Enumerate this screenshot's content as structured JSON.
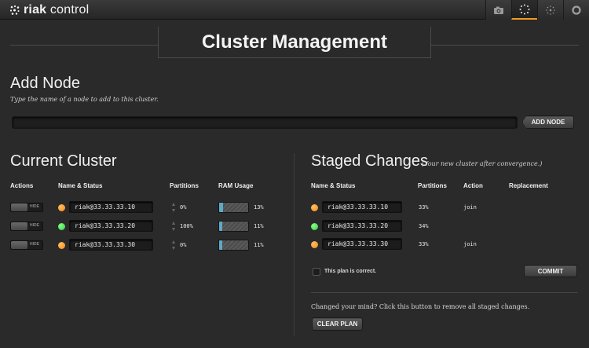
{
  "app": {
    "logo_bold": "riak",
    "logo_rest": " control"
  },
  "nav": [
    {
      "name": "snapshot",
      "icon": "camera-icon",
      "active": false
    },
    {
      "name": "cluster",
      "icon": "cluster-icon",
      "active": true
    },
    {
      "name": "ring",
      "icon": "ring-icon",
      "active": false
    },
    {
      "name": "nodes",
      "icon": "circle-icon",
      "active": false
    }
  ],
  "page": {
    "title": "Cluster Management"
  },
  "add_node": {
    "heading": "Add Node",
    "hint": "Type the name of a node to add to this cluster.",
    "input_value": "",
    "button": "ADD NODE"
  },
  "current": {
    "heading": "Current Cluster",
    "columns": {
      "actions": "Actions",
      "name": "Name & Status",
      "partitions": "Partitions",
      "ram": "RAM Usage"
    },
    "rows": [
      {
        "toggle": "HIDE",
        "status": "orange",
        "name": "riak@33.33.33.10",
        "partitions": "0%",
        "ram": "13%",
        "ram_fraction": 0.13
      },
      {
        "toggle": "HIDE",
        "status": "green",
        "name": "riak@33.33.33.20",
        "partitions": "100%",
        "ram": "11%",
        "ram_fraction": 0.11
      },
      {
        "toggle": "HIDE",
        "status": "orange",
        "name": "riak@33.33.33.30",
        "partitions": "0%",
        "ram": "11%",
        "ram_fraction": 0.11
      }
    ]
  },
  "staged": {
    "heading": "Staged Changes",
    "subheading": "(Your new cluster after convergence.)",
    "columns": {
      "name": "Name & Status",
      "partitions": "Partitions",
      "action": "Action",
      "replacement": "Replacement"
    },
    "rows": [
      {
        "status": "orange",
        "name": "riak@33.33.33.10",
        "partitions": "33%",
        "action": "join"
      },
      {
        "status": "green",
        "name": "riak@33.33.33.20",
        "partitions": "34%",
        "action": ""
      },
      {
        "status": "orange",
        "name": "riak@33.33.33.30",
        "partitions": "33%",
        "action": "join"
      }
    ],
    "confirm_label": "This plan is correct.",
    "commit_button": "COMMIT",
    "clear_text": "Changed your mind? Click this button to remove all staged changes.",
    "clear_button": "CLEAR PLAN"
  },
  "colors": {
    "accent": "#f39c1a",
    "status_orange": "#f28a14",
    "status_green": "#2ecc40",
    "ram_fill": "#5fa9c6"
  }
}
